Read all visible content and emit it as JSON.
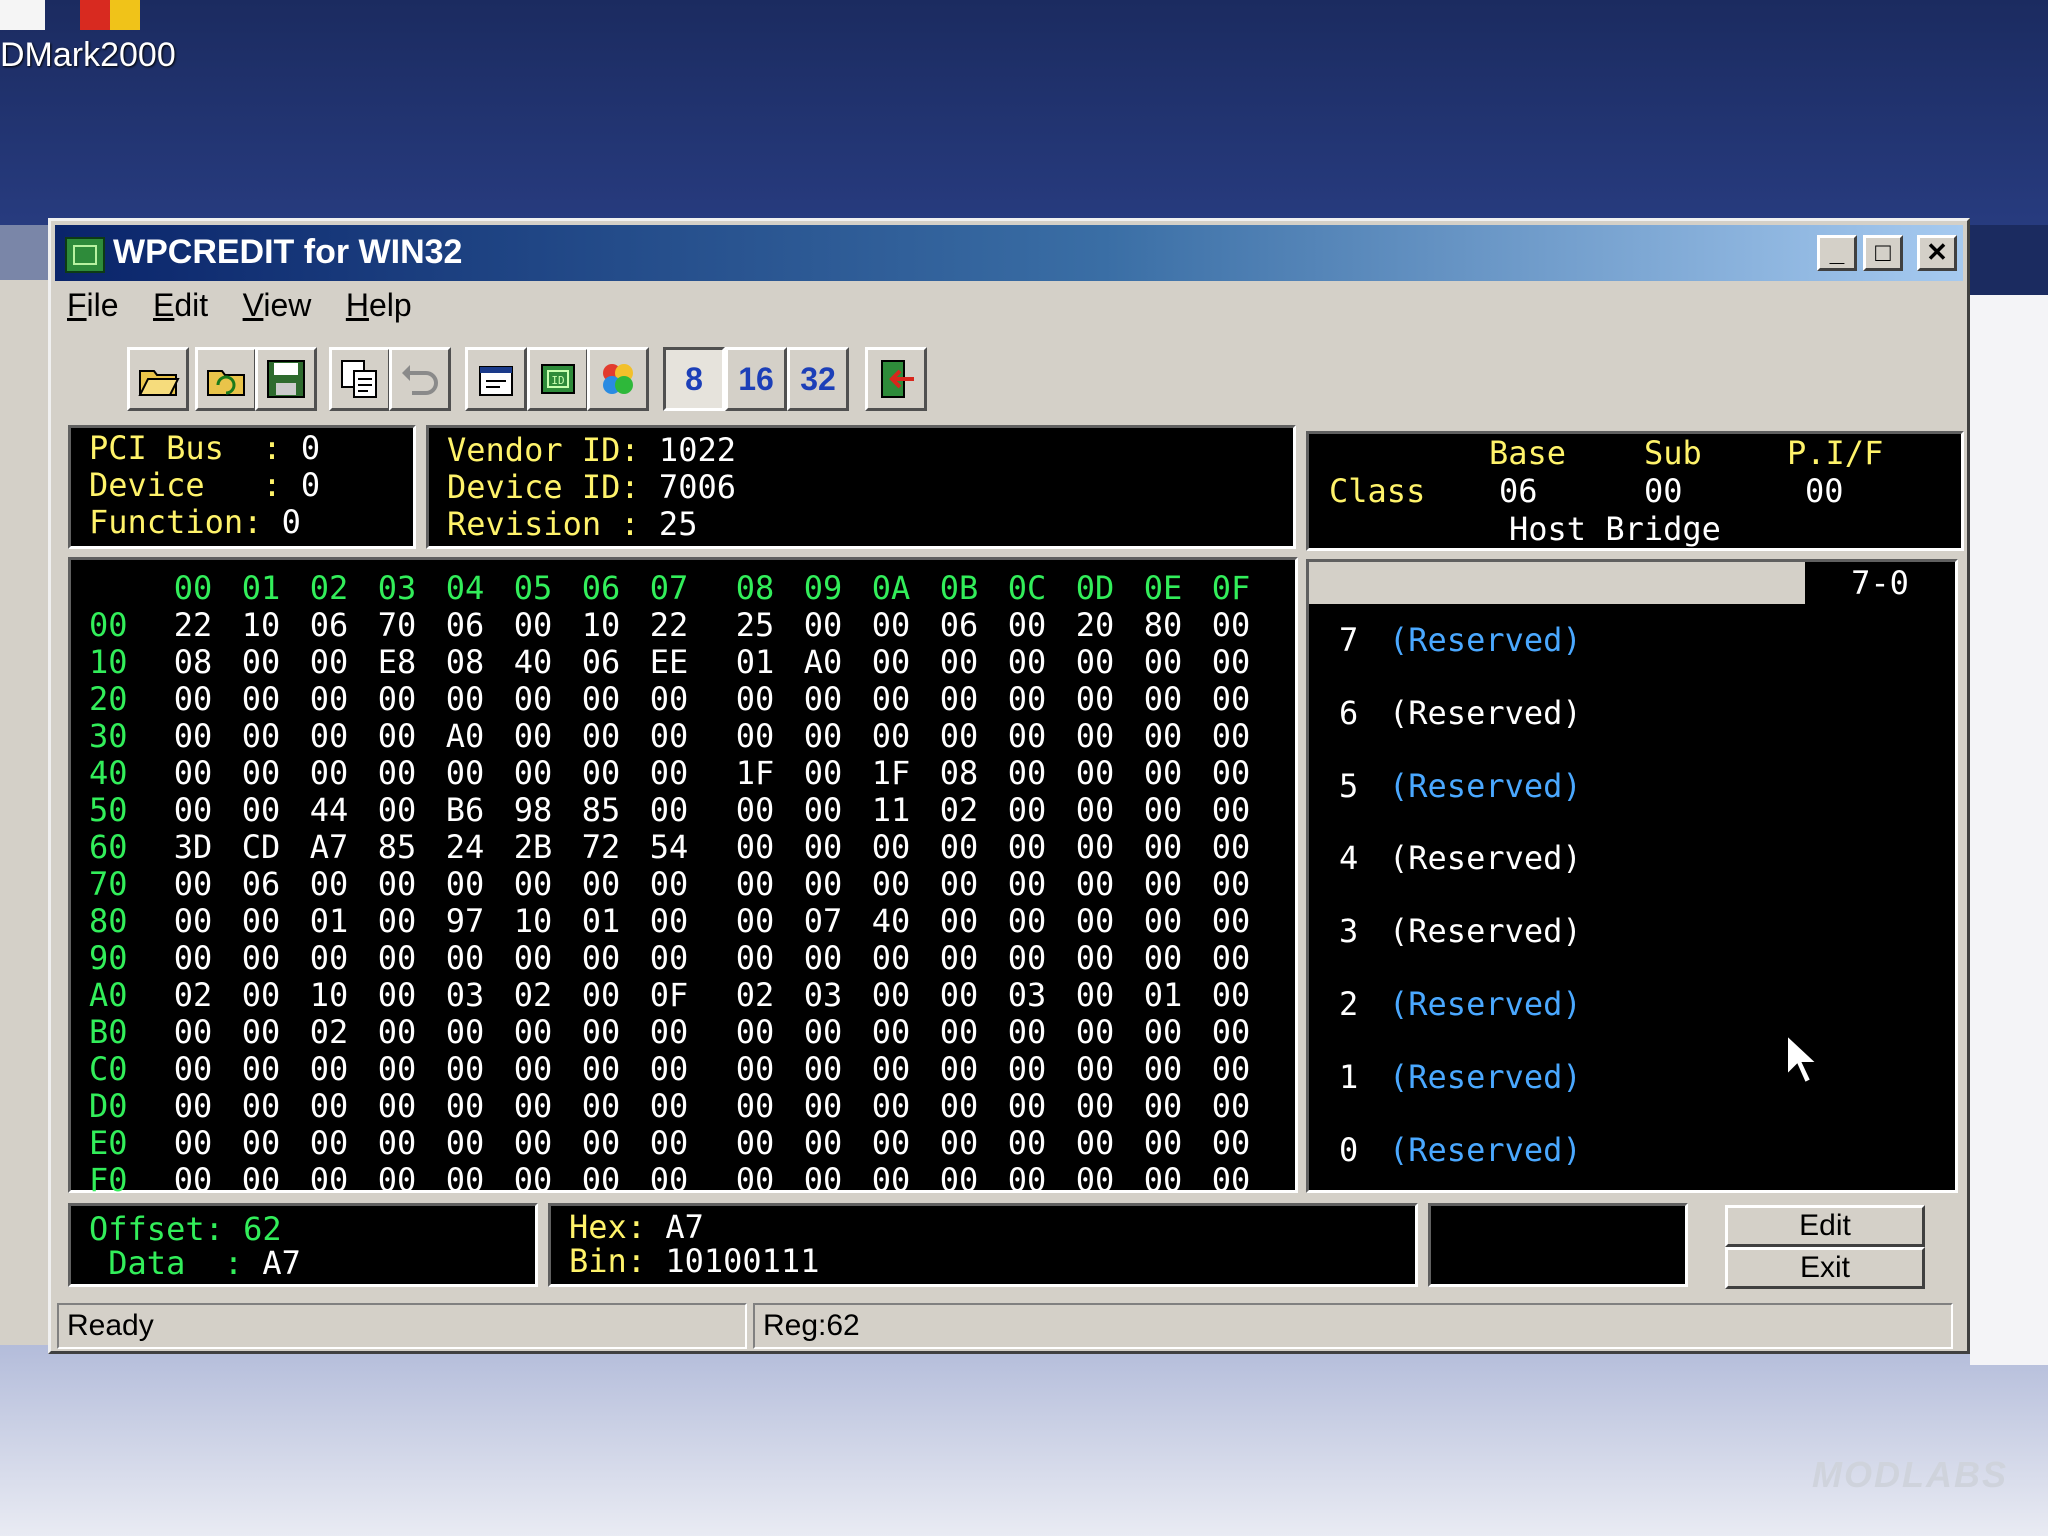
{
  "desktop": {
    "icon_label": "DMark2000"
  },
  "window": {
    "title": "WPCREDIT for WIN32",
    "controls": {
      "minimize": "_",
      "maximize": "□",
      "close": "✕"
    }
  },
  "menu": [
    "File",
    "Edit",
    "View",
    "Help"
  ],
  "toolbar": {
    "width_buttons": [
      "8",
      "16",
      "32"
    ],
    "icons": [
      "open-icon",
      "reload-icon",
      "save-icon",
      "copy-icon",
      "undo-icon",
      "properties-icon",
      "chip-icon",
      "color-icon",
      "exit-icon"
    ]
  },
  "pci": {
    "bus_label": "PCI Bus  :",
    "bus": "0",
    "device_label": "Device   :",
    "device": "0",
    "function_label": "Function:",
    "function": "0"
  },
  "ids": {
    "vendor_label": "Vendor ID:",
    "vendor": "1022",
    "device_label": "Device ID:",
    "device": "7006",
    "revision_label": "Revision :",
    "revision": "25"
  },
  "class_info": {
    "label": "Class",
    "base_label": "Base",
    "sub_label": "Sub",
    "pif_label": "P.I/F",
    "base": "06",
    "sub": "00",
    "pif": "00",
    "name": "Host Bridge"
  },
  "hex": {
    "columns": [
      "00",
      "01",
      "02",
      "03",
      "04",
      "05",
      "06",
      "07",
      "08",
      "09",
      "0A",
      "0B",
      "0C",
      "0D",
      "0E",
      "0F"
    ],
    "rows": [
      {
        "addr": "00",
        "bytes": [
          "22",
          "10",
          "06",
          "70",
          "06",
          "00",
          "10",
          "22",
          "25",
          "00",
          "00",
          "06",
          "00",
          "20",
          "80",
          "00"
        ]
      },
      {
        "addr": "10",
        "bytes": [
          "08",
          "00",
          "00",
          "E8",
          "08",
          "40",
          "06",
          "EE",
          "01",
          "A0",
          "00",
          "00",
          "00",
          "00",
          "00",
          "00"
        ]
      },
      {
        "addr": "20",
        "bytes": [
          "00",
          "00",
          "00",
          "00",
          "00",
          "00",
          "00",
          "00",
          "00",
          "00",
          "00",
          "00",
          "00",
          "00",
          "00",
          "00"
        ]
      },
      {
        "addr": "30",
        "bytes": [
          "00",
          "00",
          "00",
          "00",
          "A0",
          "00",
          "00",
          "00",
          "00",
          "00",
          "00",
          "00",
          "00",
          "00",
          "00",
          "00"
        ]
      },
      {
        "addr": "40",
        "bytes": [
          "00",
          "00",
          "00",
          "00",
          "00",
          "00",
          "00",
          "00",
          "1F",
          "00",
          "1F",
          "08",
          "00",
          "00",
          "00",
          "00"
        ]
      },
      {
        "addr": "50",
        "bytes": [
          "00",
          "00",
          "44",
          "00",
          "B6",
          "98",
          "85",
          "00",
          "00",
          "00",
          "11",
          "02",
          "00",
          "00",
          "00",
          "00"
        ]
      },
      {
        "addr": "60",
        "bytes": [
          "3D",
          "CD",
          "A7",
          "85",
          "24",
          "2B",
          "72",
          "54",
          "00",
          "00",
          "00",
          "00",
          "00",
          "00",
          "00",
          "00"
        ]
      },
      {
        "addr": "70",
        "bytes": [
          "00",
          "06",
          "00",
          "00",
          "00",
          "00",
          "00",
          "00",
          "00",
          "00",
          "00",
          "00",
          "00",
          "00",
          "00",
          "00"
        ]
      },
      {
        "addr": "80",
        "bytes": [
          "00",
          "00",
          "01",
          "00",
          "97",
          "10",
          "01",
          "00",
          "00",
          "07",
          "40",
          "00",
          "00",
          "00",
          "00",
          "00"
        ]
      },
      {
        "addr": "90",
        "bytes": [
          "00",
          "00",
          "00",
          "00",
          "00",
          "00",
          "00",
          "00",
          "00",
          "00",
          "00",
          "00",
          "00",
          "00",
          "00",
          "00"
        ]
      },
      {
        "addr": "A0",
        "bytes": [
          "02",
          "00",
          "10",
          "00",
          "03",
          "02",
          "00",
          "0F",
          "02",
          "03",
          "00",
          "00",
          "03",
          "00",
          "01",
          "00"
        ]
      },
      {
        "addr": "B0",
        "bytes": [
          "00",
          "00",
          "02",
          "00",
          "00",
          "00",
          "00",
          "00",
          "00",
          "00",
          "00",
          "00",
          "00",
          "00",
          "00",
          "00"
        ]
      },
      {
        "addr": "C0",
        "bytes": [
          "00",
          "00",
          "00",
          "00",
          "00",
          "00",
          "00",
          "00",
          "00",
          "00",
          "00",
          "00",
          "00",
          "00",
          "00",
          "00"
        ]
      },
      {
        "addr": "D0",
        "bytes": [
          "00",
          "00",
          "00",
          "00",
          "00",
          "00",
          "00",
          "00",
          "00",
          "00",
          "00",
          "00",
          "00",
          "00",
          "00",
          "00"
        ]
      },
      {
        "addr": "E0",
        "bytes": [
          "00",
          "00",
          "00",
          "00",
          "00",
          "00",
          "00",
          "00",
          "00",
          "00",
          "00",
          "00",
          "00",
          "00",
          "00",
          "00"
        ]
      },
      {
        "addr": "F0",
        "bytes": [
          "00",
          "00",
          "00",
          "00",
          "00",
          "00",
          "00",
          "00",
          "00",
          "00",
          "00",
          "00",
          "00",
          "00",
          "00",
          "00"
        ]
      }
    ]
  },
  "bits": {
    "tab_label": "7-0",
    "items": [
      {
        "bit": "7",
        "label": "(Reserved)",
        "state": "off"
      },
      {
        "bit": "6",
        "label": "(Reserved)",
        "state": "on"
      },
      {
        "bit": "5",
        "label": "(Reserved)",
        "state": "off"
      },
      {
        "bit": "4",
        "label": "(Reserved)",
        "state": "on"
      },
      {
        "bit": "3",
        "label": "(Reserved)",
        "state": "on"
      },
      {
        "bit": "2",
        "label": "(Reserved)",
        "state": "off"
      },
      {
        "bit": "1",
        "label": "(Reserved)",
        "state": "off"
      },
      {
        "bit": "0",
        "label": "(Reserved)",
        "state": "off"
      }
    ]
  },
  "offset_panel": {
    "offset_label": "Offset:",
    "offset": "62",
    "data_label": " Data  :",
    "data": "A7"
  },
  "value_panel": {
    "hex_label": "Hex:",
    "hex": "A7",
    "bin_label": "Bin:",
    "bin": "10100111"
  },
  "buttons": {
    "edit": "Edit",
    "exit": "Exit"
  },
  "status": {
    "left": "Ready",
    "right": "Reg:62"
  },
  "colors": {
    "bit_on": "#ffffff",
    "bit_off": "#4aa8ff",
    "hex_header": "#32ee5a",
    "field_label": "#fff36a"
  }
}
